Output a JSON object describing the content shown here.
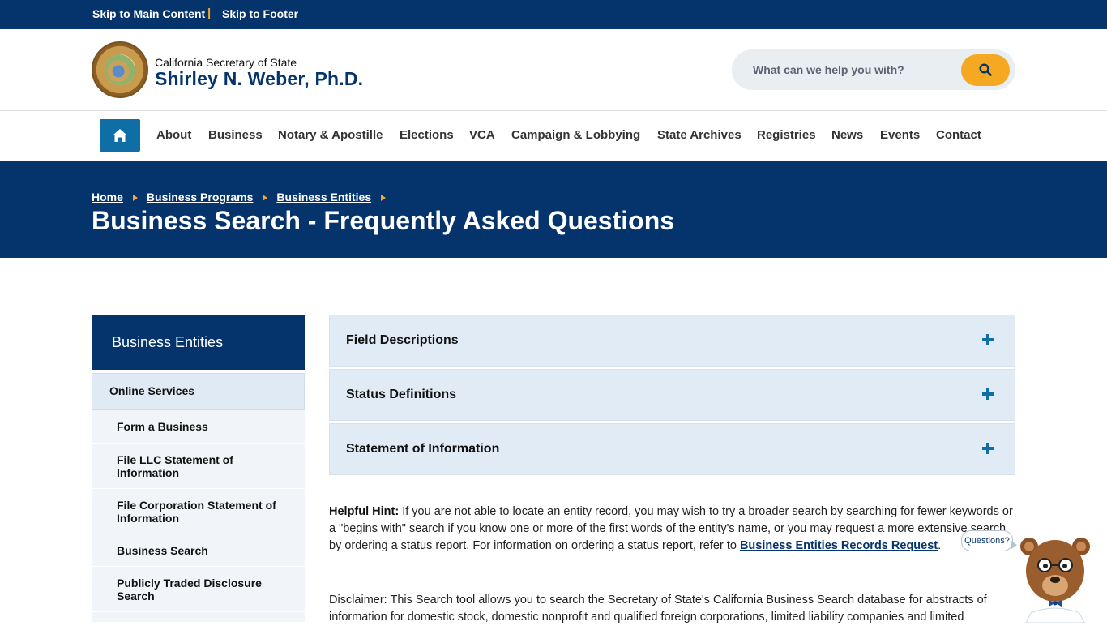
{
  "skip_links": {
    "main": "Skip to Main Content",
    "separator": "|",
    "footer": "Skip to Footer"
  },
  "header": {
    "org_sub": "California Secretary of State",
    "org_name": "Shirley N. Weber, Ph.D.",
    "search_placeholder": "What can we help you with?"
  },
  "nav": {
    "items": [
      "About",
      "Business",
      "Notary & Apostille",
      "Elections",
      "VCA",
      "Campaign & Lobbying",
      "State Archives",
      "Registries",
      "News",
      "Events",
      "Contact"
    ]
  },
  "breadcrumb": [
    "Home",
    "Business Programs",
    "Business Entities"
  ],
  "page_title": "Business Search - Frequently Asked Questions",
  "sidebar": {
    "title": "Business Entities",
    "section": "Online Services",
    "items": [
      "Form a Business",
      "File LLC Statement of Information",
      "File Corporation Statement of Information",
      "Business Search",
      "Publicly Traded Disclosure Search"
    ]
  },
  "accordion": [
    "Field Descriptions",
    "Status Definitions",
    "Statement of Information"
  ],
  "hint": {
    "label": "Helpful Hint:",
    "text": " If you are not able to locate an entity record, you may wish to try a broader search by searching for fewer keywords or a \"begins with\" search if you know one or more of the first words of the entity's name, or you may request a more extensive search by ordering a status report. For information on ordering a status report, refer to ",
    "link": "Business Entities Records Request",
    "end": "."
  },
  "disclaimer": "Disclaimer: This Search tool allows you to search the Secretary of State's California Business Search database for abstracts of information for domestic stock, domestic nonprofit and qualified foreign corporations, limited liability companies and limited",
  "chat": {
    "bubble": "Questions?"
  },
  "colors": {
    "navy": "#04346b",
    "accent": "#f5a923",
    "blue": "#0f6fa5",
    "panel": "#e1ebf5"
  }
}
